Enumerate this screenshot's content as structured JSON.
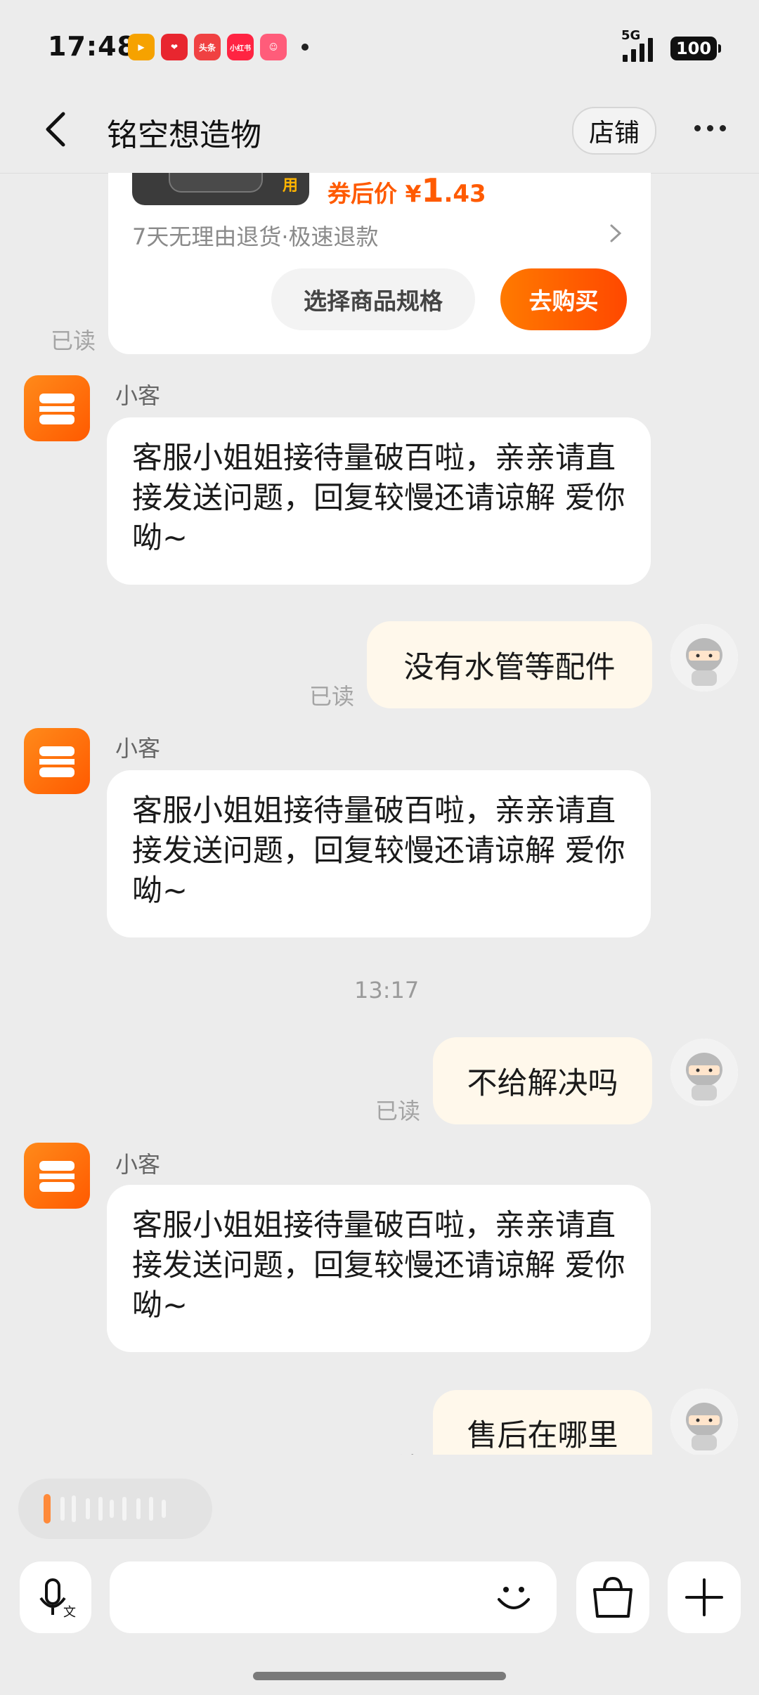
{
  "status_bar": {
    "time": "17:48",
    "network": "5G",
    "battery": "100",
    "app_icons": [
      {
        "name": "video-app-icon",
        "label": "",
        "color": "#f6a200"
      },
      {
        "name": "heart-app-icon",
        "label": "",
        "color": "#e8262f"
      },
      {
        "name": "toutiao-app-icon",
        "label": "头条",
        "color": "#f04142"
      },
      {
        "name": "xiaohongshu-app-icon",
        "label": "小红书",
        "color": "#ff2442"
      },
      {
        "name": "game-app-icon",
        "label": "",
        "color": "#ff5c7a"
      }
    ]
  },
  "nav": {
    "title": "铭空想造物",
    "shop_label": "店铺"
  },
  "product_card": {
    "thumb_tag": "用",
    "price_prefix": "券后价",
    "currency": "¥",
    "price_int": "1",
    "price_dec": ".43",
    "policy": "7天无理由退货·极速退款",
    "spec_label": "选择商品规格",
    "buy_label": "去购买",
    "read_label": "已读"
  },
  "messages": {
    "m1": {
      "sender": "小客",
      "text": "客服小姐姐接待量破百啦，亲亲请直接发送问题，回复较慢还请谅解 爱你呦~"
    },
    "m2": {
      "text": "没有水管等配件",
      "read_label": "已读"
    },
    "m3": {
      "sender": "小客",
      "text": "客服小姐姐接待量破百啦，亲亲请直接发送问题，回复较慢还请谅解 爱你呦~"
    },
    "timestamp": "13:17",
    "m4": {
      "text": "不给解决吗",
      "read_label": "已读"
    },
    "m5": {
      "sender": "小客",
      "text": "客服小姐姐接待量破百啦，亲亲请直接发送问题，回复较慢还请谅解 爱你呦~"
    },
    "m6": {
      "text": "售后在哪里",
      "read_label": "已读"
    }
  },
  "colors": {
    "accent": "#ff5a00",
    "self_bubble": "#fff8eb",
    "background": "#ececec"
  }
}
